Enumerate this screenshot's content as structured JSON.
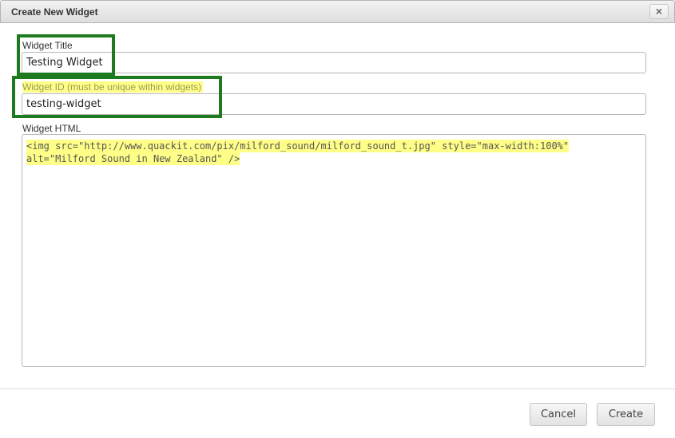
{
  "dialog": {
    "title": "Create New Widget",
    "close_label": "×"
  },
  "form": {
    "title_label": "Widget Title",
    "title_value": "Testing Widget",
    "id_label": "Widget ID (must be unique within widgets)",
    "id_value": "testing-widget",
    "html_label": "Widget HTML",
    "html_lines": [
      "<img src=\"http://www.quackit.com/pix/milford_sound/milford_sound_t.jpg\" style=\"max-width:100%\"",
      "alt=\"Milford Sound in New Zealand\" />"
    ]
  },
  "buttons": {
    "cancel": "Cancel",
    "create": "Create"
  },
  "colors": {
    "highlight": "#ffff88",
    "annotation_box": "#1e7a1e"
  }
}
